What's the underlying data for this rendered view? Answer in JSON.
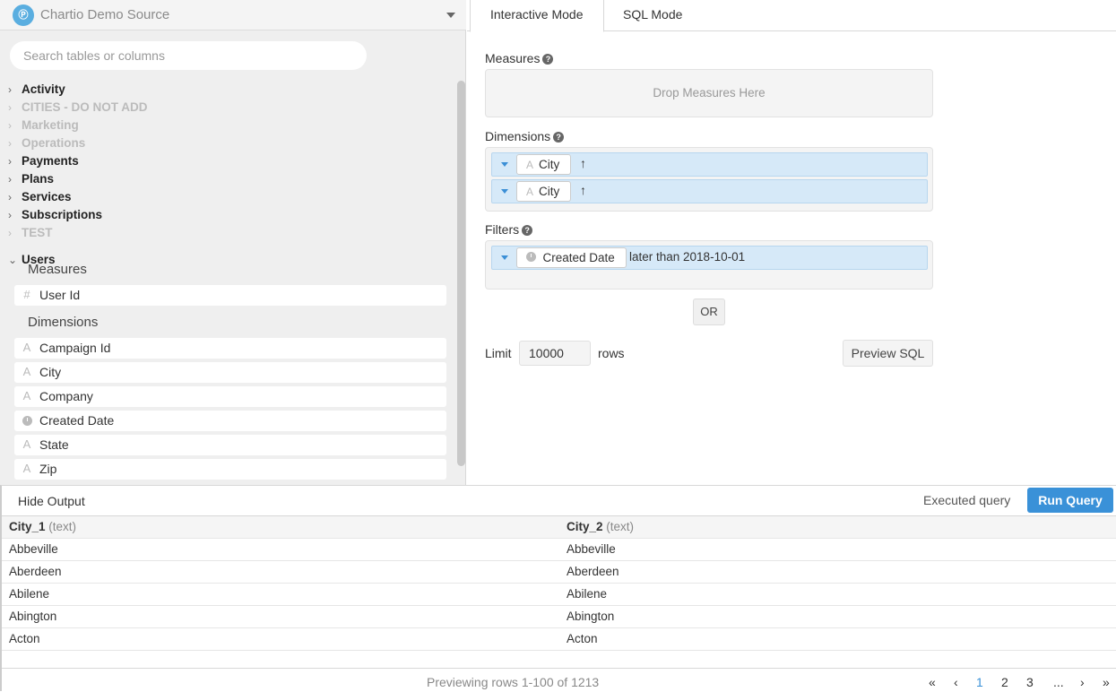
{
  "source": {
    "name": "Chartio Demo Source",
    "logo": "Ⓟ"
  },
  "search": {
    "placeholder": "Search tables or columns"
  },
  "tables": [
    {
      "name": "Activity",
      "enabled": true
    },
    {
      "name": "CITIES - DO NOT ADD",
      "enabled": false
    },
    {
      "name": "Marketing",
      "enabled": false
    },
    {
      "name": "Operations",
      "enabled": false
    },
    {
      "name": "Payments",
      "enabled": true
    },
    {
      "name": "Plans",
      "enabled": true
    },
    {
      "name": "Services",
      "enabled": true
    },
    {
      "name": "Subscriptions",
      "enabled": true
    },
    {
      "name": "TEST",
      "enabled": false
    }
  ],
  "users": {
    "name": "Users",
    "measures_label": "Measures",
    "measures": [
      {
        "name": "User Id",
        "type": "number"
      }
    ],
    "dimensions_label": "Dimensions",
    "dimensions": [
      {
        "name": "Campaign Id",
        "type": "text"
      },
      {
        "name": "City",
        "type": "text"
      },
      {
        "name": "Company",
        "type": "text"
      },
      {
        "name": "Created Date",
        "type": "date"
      },
      {
        "name": "State",
        "type": "text"
      },
      {
        "name": "Zip",
        "type": "text"
      }
    ]
  },
  "tabs": {
    "interactive": "Interactive Mode",
    "sql": "SQL Mode"
  },
  "builder": {
    "measures_label": "Measures",
    "measures_drop": "Drop Measures Here",
    "dimensions_label": "Dimensions",
    "dimensions": [
      {
        "name": "City",
        "sort": "↑"
      },
      {
        "name": "City",
        "sort": "↑"
      }
    ],
    "filters_label": "Filters",
    "filter": {
      "name": "Created Date",
      "value": "later than 2018-10-01"
    },
    "or_label": "OR",
    "limit_label": "Limit",
    "limit_value": "10000",
    "rows_label": "rows",
    "preview_sql": "Preview SQL"
  },
  "output": {
    "hide_label": "Hide Output",
    "executed_label": "Executed query",
    "run_label": "Run Query",
    "columns": [
      {
        "name": "City_1",
        "type": "(text)"
      },
      {
        "name": "City_2",
        "type": "(text)"
      }
    ],
    "rows": [
      [
        "Abbeville",
        "Abbeville"
      ],
      [
        "Aberdeen",
        "Aberdeen"
      ],
      [
        "Abilene",
        "Abilene"
      ],
      [
        "Abington",
        "Abington"
      ],
      [
        "Acton",
        "Acton"
      ]
    ],
    "preview_info": "Previewing rows 1-100 of 1213",
    "pager": {
      "first": "«",
      "prev": "‹",
      "pages": [
        "1",
        "2",
        "3"
      ],
      "current": "1",
      "ellipsis": "...",
      "next": "›",
      "last": "»"
    }
  },
  "colors": {
    "accent": "#3a91d8",
    "pill": "#d6e9f8"
  }
}
